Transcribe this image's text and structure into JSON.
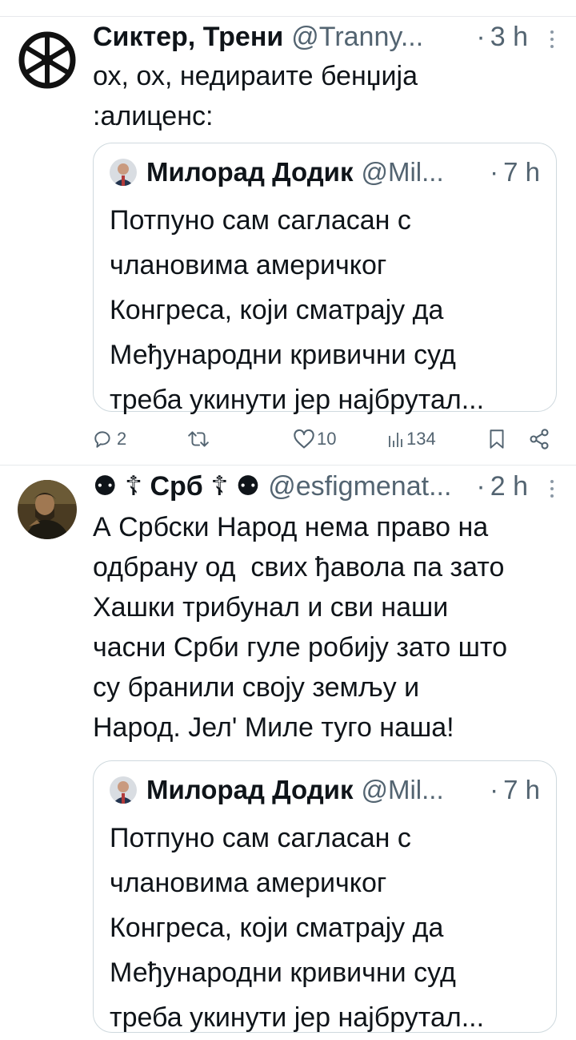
{
  "tweets": [
    {
      "author_name": "Сиктер, Трени",
      "handle": "@Tranny...",
      "time": "3 h",
      "time_dot": "·",
      "text": "ох, ох, недираите бенџија\n:алиценс:",
      "quote": {
        "author_name": "Милорад Додик",
        "handle": "@Mil...",
        "time": "7 h",
        "time_dot": "·",
        "text": "Потпуно сам сагласан с\nчлановима америчког\nКонгреса, који сматрају да\nМеђународни кривични суд\nтреба укинути јер најбрутал..."
      },
      "actions": {
        "replies": "2",
        "retweets": "",
        "likes": "10",
        "views": "134"
      }
    },
    {
      "author_name": "⚉ ☦ Срб ☦ ⚉",
      "handle": "@esfigmenat...",
      "time": "2 h",
      "time_dot": "·",
      "text": "А Србски Народ нема право на\nодбрану од  свих ђавола па зато\nХашки трибунал и сви наши\nчасни Срби гуле робију зато што\nсу бранили своју земљу и\nНарод. Јел' Миле туго наша!",
      "quote": {
        "author_name": "Милорад Додик",
        "handle": "@Mil...",
        "time": "7 h",
        "time_dot": "·",
        "text": "Потпуно сам сагласан с\nчлановима америчког\nКонгреса, који сматрају да\nМеђународни кривични суд\nтреба укинути јер најбрутал..."
      }
    }
  ],
  "colors": {
    "text": "#0f1419",
    "secondary": "#536471",
    "border": "#cfd9de",
    "divider": "#e7e9ec"
  },
  "icons": [
    "wheel-symbol-icon",
    "more-icon",
    "reply-icon",
    "retweet-icon",
    "like-icon",
    "views-icon",
    "bookmark-icon",
    "share-icon"
  ]
}
